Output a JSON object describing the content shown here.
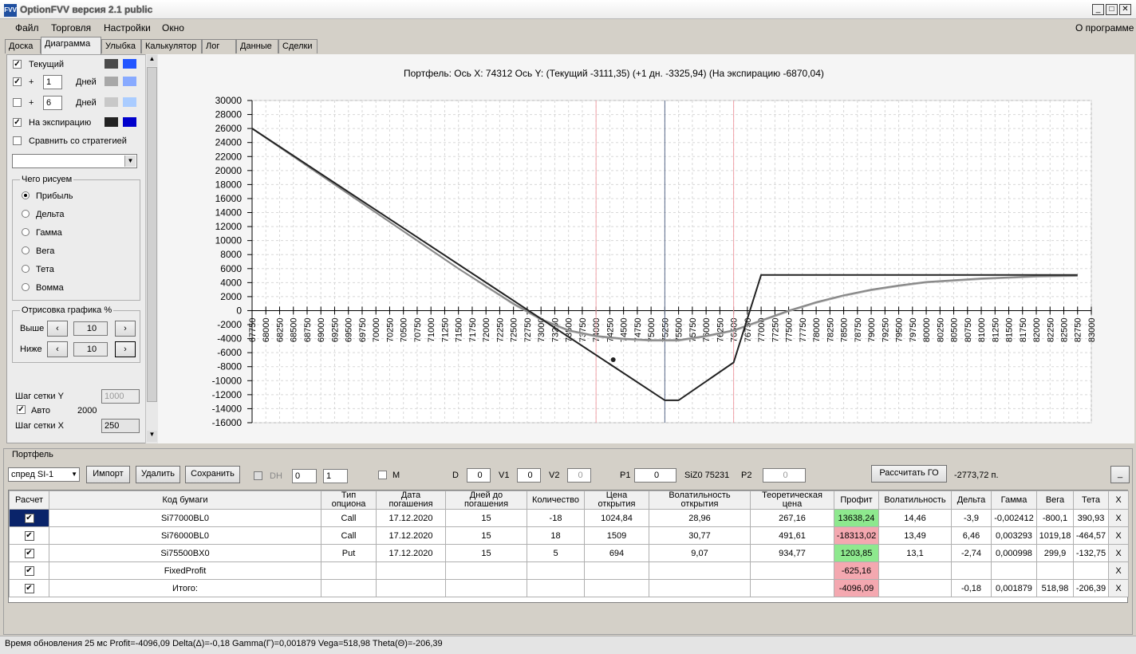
{
  "window": {
    "title": "OptionFVV версия 2.1 public",
    "icon": "app-icon"
  },
  "menu": {
    "items": [
      "Файл",
      "Торговля",
      "Настройки",
      "Окно"
    ],
    "about": "О программе"
  },
  "tabs": [
    "Доска",
    "Диаграмма",
    "Улыбка",
    "Калькулятор",
    "Лог",
    "Данные",
    "Сделки"
  ],
  "left": {
    "current_label": "Текущий",
    "plus": "+",
    "days_label": "Дней",
    "days1": "1",
    "days2": "6",
    "expiration_label": "На экспирацию",
    "compare_label": "Сравнить со стратегией",
    "draw_group": "Чего рисуем",
    "radios": [
      "Прибыль",
      "Дельта",
      "Гамма",
      "Вега",
      "Тета",
      "Вомма"
    ],
    "render_group": "Отрисовка графика %",
    "above_label": "Выше",
    "below_label": "Ниже",
    "above_value": "10",
    "below_value": "10",
    "gridy_label": "Шаг сетки Y",
    "gridy_value": "1000",
    "auto_label": "Авто",
    "auto_value": "2000",
    "gridx_label": "Шаг сетки X",
    "gridx_value": "250",
    "colors": {
      "current": [
        "#4a4a4a",
        "#2255ff"
      ],
      "d1": [
        "#a8a8a8",
        "#88aaff"
      ],
      "d2": [
        "#c8c8c8",
        "#aaccff"
      ],
      "exp": [
        "#222222",
        "#0000cc"
      ]
    }
  },
  "chart_header": {
    "portfolio": "Портфель:",
    "axis_x": "Ось X:",
    "x_val": "74312",
    "axis_y": "Ось Y:",
    "current": "(Текущий -3111,35)",
    "plus1": "(+1 дн. -3325,94)",
    "expiration": "(На экспирацию -6870,04)"
  },
  "chart_data": {
    "type": "line",
    "ylim": [
      -16000,
      30000
    ],
    "xlim": [
      67750,
      83000
    ],
    "yticks": [
      30000,
      28000,
      26000,
      24000,
      22000,
      20000,
      18000,
      16000,
      14000,
      12000,
      10000,
      8000,
      6000,
      4000,
      2000,
      0,
      -2000,
      -4000,
      -6000,
      -8000,
      -10000,
      -12000,
      -14000,
      -16000
    ],
    "xticks": [
      67750,
      68000,
      68250,
      68500,
      68750,
      69000,
      69250,
      69500,
      69750,
      70000,
      70250,
      70500,
      70750,
      71000,
      71250,
      71500,
      71750,
      72000,
      72250,
      72500,
      72750,
      73000,
      73250,
      73500,
      73750,
      74000,
      74250,
      74500,
      74750,
      75000,
      75250,
      75500,
      75750,
      76000,
      76250,
      76500,
      76750,
      77000,
      77250,
      77500,
      77750,
      78000,
      78250,
      78500,
      78750,
      79000,
      79250,
      79500,
      79750,
      80000,
      80250,
      80500,
      80750,
      81000,
      81250,
      81500,
      81750,
      82000,
      82250,
      82500,
      82750,
      83000
    ],
    "vlines": {
      "red": [
        74000,
        76500
      ],
      "blue": 75250
    },
    "series": [
      {
        "values": [
          [
            67750,
            26000
          ],
          [
            75250,
            -12800
          ],
          [
            75500,
            -12800
          ],
          [
            76500,
            -7400
          ],
          [
            77000,
            5100
          ],
          [
            82750,
            5100
          ]
        ],
        "color": "#222222"
      },
      {
        "values": [
          [
            67750,
            26000
          ],
          [
            71500,
            6000
          ],
          [
            72500,
            1000
          ],
          [
            73000,
            -1200
          ],
          [
            73500,
            -2800
          ],
          [
            74000,
            -3600
          ],
          [
            74500,
            -4000
          ],
          [
            75000,
            -4200
          ],
          [
            75500,
            -4200
          ],
          [
            76000,
            -3600
          ],
          [
            76500,
            -2800
          ],
          [
            77000,
            -1400
          ],
          [
            77500,
            0
          ],
          [
            78000,
            1200
          ],
          [
            78500,
            2200
          ],
          [
            79000,
            3000
          ],
          [
            79500,
            3600
          ],
          [
            80000,
            4100
          ],
          [
            81000,
            4600
          ],
          [
            82000,
            4900
          ],
          [
            82750,
            5000
          ]
        ],
        "color": "#888888"
      },
      {
        "values": [
          [
            67750,
            26000
          ],
          [
            71500,
            6000
          ],
          [
            72500,
            900
          ],
          [
            73000,
            -1300
          ],
          [
            73500,
            -2900
          ],
          [
            74000,
            -3700
          ],
          [
            74500,
            -4100
          ],
          [
            75000,
            -4300
          ],
          [
            75500,
            -4300
          ],
          [
            76000,
            -3700
          ],
          [
            76500,
            -2900
          ],
          [
            77000,
            -1500
          ],
          [
            77500,
            -100
          ],
          [
            78000,
            1100
          ],
          [
            78500,
            2100
          ],
          [
            79000,
            2900
          ],
          [
            79500,
            3500
          ],
          [
            80000,
            4000
          ],
          [
            81000,
            4500
          ],
          [
            82000,
            4850
          ],
          [
            82750,
            4950
          ]
        ],
        "color": "#b0b0b0"
      }
    ],
    "marker": [
      74312,
      -7000
    ]
  },
  "portfolio": {
    "group_title": "Портфель",
    "select": "спред SI-1",
    "import": "Импорт",
    "delete": "Удалить",
    "save": "Сохранить",
    "dh": "DH",
    "spin1": "0",
    "spin2": "1",
    "m": "M",
    "d_label": "D",
    "d_val": "0",
    "v1_label": "V1",
    "v1_val": "0",
    "v2_label": "V2",
    "v2_val": "0",
    "p1_label": "P1",
    "p1_val": "0",
    "siz": "SiZ0 75231",
    "p2_label": "P2",
    "p2_val": "0",
    "calc_go": "Рассчитать ГО",
    "go_value": "-2773,72 п.",
    "min_btn": "_"
  },
  "table": {
    "headers": [
      "Расчет",
      "Код бумаги",
      "Тип опциона",
      "Дата погашения",
      "Дней до погашения",
      "Количество",
      "Цена открытия",
      "Волатильность открытия",
      "Теоретическая цена",
      "Профит",
      "Волатильность",
      "Дельта",
      "Гамма",
      "Вега",
      "Тета",
      "X"
    ],
    "rows": [
      [
        "✔",
        "Si77000BL0",
        "Call",
        "17.12.2020",
        "15",
        "-18",
        "1024,84",
        "28,96",
        "267,16",
        "13638,24",
        "14,46",
        "-3,9",
        "-0,002412",
        "-800,1",
        "390,93",
        "X"
      ],
      [
        "✔",
        "Si76000BL0",
        "Call",
        "17.12.2020",
        "15",
        "18",
        "1509",
        "30,77",
        "491,61",
        "-18313,02",
        "13,49",
        "6,46",
        "0,003293",
        "1019,18",
        "-464,57",
        "X"
      ],
      [
        "✔",
        "Si75500BX0",
        "Put",
        "17.12.2020",
        "15",
        "5",
        "694",
        "9,07",
        "934,77",
        "1203,85",
        "13,1",
        "-2,74",
        "0,000998",
        "299,9",
        "-132,75",
        "X"
      ],
      [
        "✔",
        "FixedProfit",
        "",
        "",
        "",
        "",
        "",
        "",
        "",
        "-625,16",
        "",
        "",
        "",
        "",
        "",
        "X"
      ],
      [
        "✔",
        "Итого:",
        "",
        "",
        "",
        "",
        "",
        "",
        "",
        "-4096,09",
        "",
        "-0,18",
        "0,001879",
        "518,98",
        "-206,39",
        "X"
      ]
    ],
    "profit_colors": [
      "green",
      "red",
      "green",
      "red",
      "red"
    ]
  },
  "status": "Время обновления 25 мс  Profit=-4096,09 Delta(Δ)=-0,18 Gamma(Γ)=0,001879 Vega=518,98 Theta(Θ)=-206,39"
}
